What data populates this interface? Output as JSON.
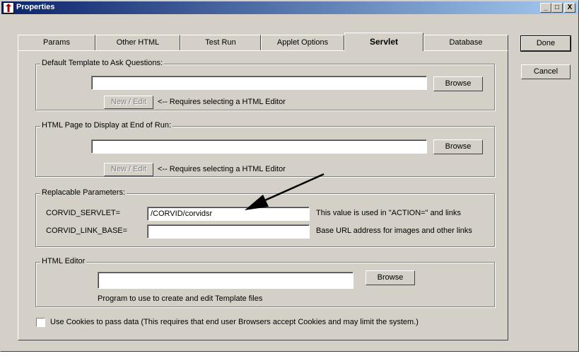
{
  "window": {
    "title": "Properties"
  },
  "titlebar_buttons": {
    "minimize": "_",
    "maximize": "□",
    "close": "X"
  },
  "tabs": [
    {
      "label": "Params",
      "active": false
    },
    {
      "label": "Other HTML",
      "active": false
    },
    {
      "label": "Test Run",
      "active": false
    },
    {
      "label": "Applet Options",
      "active": false
    },
    {
      "label": "Servlet",
      "active": true
    },
    {
      "label": "Database",
      "active": false
    }
  ],
  "side_buttons": {
    "done": "Done",
    "cancel": "Cancel"
  },
  "template_group": {
    "label": "Default Template to Ask Questions:",
    "value": "",
    "browse": "Browse",
    "new_edit": "New / Edit",
    "hint": "<-- Requires selecting a HTML Editor"
  },
  "end_page_group": {
    "label": "HTML Page to Display at End of Run:",
    "value": "",
    "browse": "Browse",
    "new_edit": "New / Edit",
    "hint": "<-- Requires selecting a HTML Editor"
  },
  "params_group": {
    "label": "Replacable Parameters:",
    "servlet_label": "CORVID_SERVLET=",
    "servlet_value": "/CORVID/corvidsr",
    "servlet_note": "This value is used in \"ACTION=\" and links",
    "link_base_label": "CORVID_LINK_BASE=",
    "link_base_value": "",
    "link_base_note": "Base URL address for images and other links"
  },
  "editor_group": {
    "label": "HTML Editor",
    "value": "",
    "browse": "Browse",
    "hint": "Program to use to create and edit Template files"
  },
  "cookies": {
    "checked": false,
    "label": "Use Cookies to pass data (This requires that end user Browsers accept Cookies and may limit the system.)"
  }
}
